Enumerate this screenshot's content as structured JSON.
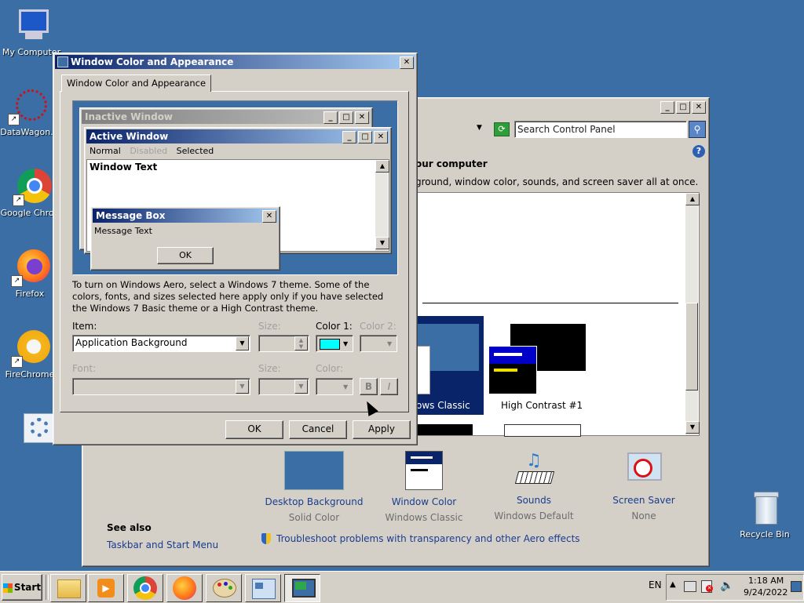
{
  "desktop": {
    "icons": [
      {
        "label": "My Computer"
      },
      {
        "label": "DataWagon."
      },
      {
        "label": "Google Chrom"
      },
      {
        "label": "Firefox"
      },
      {
        "label": "FireChrome"
      },
      {
        "label": ""
      },
      {
        "label": "Recycle Bin"
      }
    ]
  },
  "control_panel": {
    "search_placeholder": "Search Control Panel",
    "heading": "our computer",
    "description": "ground, window color, sounds, and screen saver all at once.",
    "themes": [
      {
        "label": "ows Classic"
      },
      {
        "label": "High Contrast #1"
      }
    ],
    "bottom_items": [
      {
        "title": "Desktop Background",
        "sub": "Solid Color"
      },
      {
        "title": "Window Color",
        "sub": "Windows Classic"
      },
      {
        "title": "Sounds",
        "sub": "Windows Default"
      },
      {
        "title": "Screen Saver",
        "sub": "None"
      }
    ],
    "see_also_title": "See also",
    "see_also_link": "Taskbar and Start Menu",
    "troubleshoot_link": "Troubleshoot problems with transparency and other Aero effects"
  },
  "dialog": {
    "title": "Window Color and Appearance",
    "tab": "Window Color and Appearance",
    "preview": {
      "inactive_title": "Inactive Window",
      "active_title": "Active Window",
      "menu_normal": "Normal",
      "menu_disabled": "Disabled",
      "menu_selected": "Selected",
      "window_text": "Window Text",
      "msgbox_title": "Message Box",
      "msgbox_text": "Message Text",
      "msgbox_ok": "OK"
    },
    "info_text": "To turn on Windows Aero, select a Windows 7 theme.  Some of the colors, fonts, and sizes selected here apply only if you have selected the Windows 7 Basic theme or a High Contrast theme.",
    "item_label": "Item:",
    "item_value": "Application Background",
    "size_label": "Size:",
    "color1_label": "Color 1:",
    "color2_label": "Color 2:",
    "color1_value": "#00ffff",
    "font_label": "Font:",
    "font_size_label": "Size:",
    "font_color_label": "Color:",
    "bold_label": "B",
    "italic_label": "I",
    "ok": "OK",
    "cancel": "Cancel",
    "apply": "Apply"
  },
  "taskbar": {
    "start": "Start",
    "lang": "EN",
    "time": "1:18 AM",
    "date": "9/24/2022"
  },
  "colors": {
    "desktop": "#3a6ea5",
    "title_active": "#0a246a",
    "preview_bg": "#3a6ea5"
  }
}
